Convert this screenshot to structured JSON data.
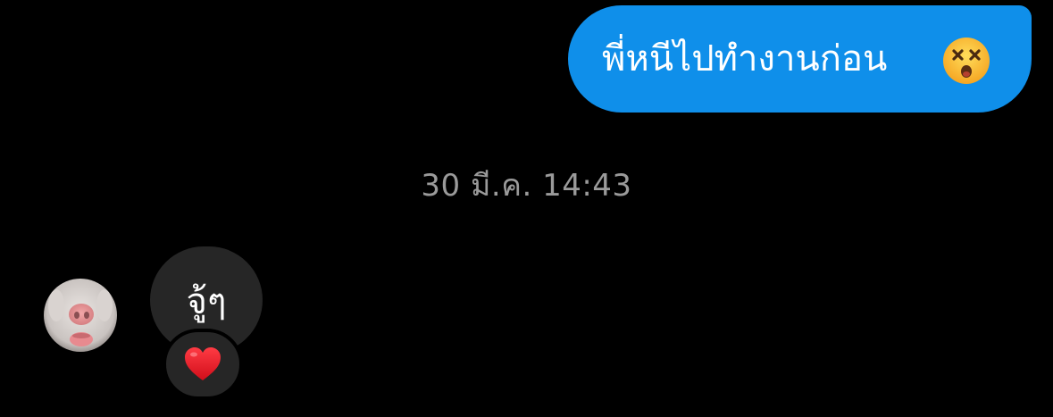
{
  "conversation": {
    "sent_message": {
      "text": "พี่หนีไปทำงานก่อน",
      "emoji_icon": "dizzy-face-icon",
      "bubble_color": "#0f8fea"
    },
    "timestamp": "30 มี.ค. 14:43",
    "received_message": {
      "text": "จู้ๆ",
      "avatar_icon": "avatar",
      "bubble_color": "#262626",
      "reaction": {
        "icon": "red-heart-icon",
        "color": "#e0131e"
      }
    }
  },
  "colors": {
    "background": "#000000",
    "timestamp_text": "#9a9a9a"
  }
}
